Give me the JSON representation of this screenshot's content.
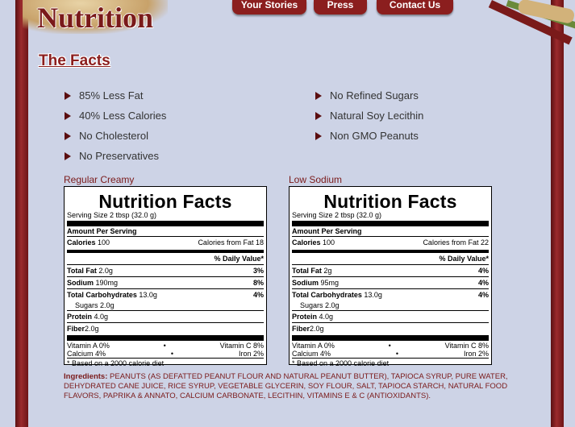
{
  "header": {
    "title": "Nutrition",
    "nav": [
      "Your Stories",
      "Press",
      "Contact Us"
    ]
  },
  "section_title": "The Facts",
  "facts_left": [
    "85% Less Fat",
    "40% Less Calories",
    "No Cholesterol",
    "No Preservatives"
  ],
  "facts_right": [
    "No Refined Sugars",
    "Natural Soy Lecithin",
    "Non GMO Peanuts"
  ],
  "labels": [
    {
      "heading": "Regular Creamy",
      "title": "Nutrition Facts",
      "serving_size": "Serving Size 2 tbsp (32.0 g)",
      "amount_per_serving": "Amount Per Serving",
      "calories_label": "Calories",
      "calories": "100",
      "calories_fat_label": "Calories from Fat",
      "calories_fat": "18",
      "daily_value": "% Daily Value",
      "nutrients": [
        {
          "name": "Total Fat",
          "amount": "2.0g",
          "pct": "3%"
        },
        {
          "name": "Sodium",
          "amount": "190mg",
          "pct": "8%"
        },
        {
          "name": "Total Carbohydrates",
          "amount": "13.0g",
          "pct": "4%"
        }
      ],
      "sugars": "Sugars 2.0g",
      "protein_label": "Protein",
      "protein": "4.0g",
      "fiber_label": "Fiber",
      "fiber": "2.0g",
      "vitamin_a": "Vitamin A 0%",
      "vitamin_c": "Vitamin C 8%",
      "calcium": "Calcium 4%",
      "iron": "Iron 2%",
      "dot": "•",
      "footnote": "* Based on a 2000 calorie diet"
    },
    {
      "heading": "Low Sodium",
      "title": "Nutrition Facts",
      "serving_size": "Serving Size 2 tbsp (32.0 g)",
      "amount_per_serving": "Amount Per Serving",
      "calories_label": "Calories",
      "calories": "100",
      "calories_fat_label": "Calories from Fat",
      "calories_fat": "22",
      "daily_value": "% Daily Value",
      "nutrients": [
        {
          "name": "Total Fat",
          "amount": "2g",
          "pct": "4%"
        },
        {
          "name": "Sodium",
          "amount": "95mg",
          "pct": "4%"
        },
        {
          "name": "Total Carbohydrates",
          "amount": "13.0g",
          "pct": "4%"
        }
      ],
      "sugars": "Sugars 2.0g",
      "protein_label": "Protein",
      "protein": "4.0g",
      "fiber_label": "Fiber",
      "fiber": "2.0g",
      "vitamin_a": "Vitamin A 0%",
      "vitamin_c": "Vitamin C 8%",
      "calcium": "Calcium 4%",
      "iron": "Iron 2%",
      "dot": "•",
      "footnote": "* Based on a 2000 calorie diet"
    }
  ],
  "ingredients": {
    "label": "Ingredients:",
    "text": "PEANUTS (AS DEFATTED PEANUT FLOUR AND NATURAL PEANUT BUTTER), TAPIOCA SYRUP, PURE WATER, DEHYDRATED CANE JUICE, RICE SYRUP, VEGETABLE GLYCERIN, SOY FLOUR, SALT, TAPIOCA STARCH, NATURAL FOOD FLAVORS, PAPRIKA & ANNATO, CALCIUM CARBONATE, LECITHIN, VITAMINS E & C (ANTIOXIDANTS)."
  },
  "colors": {
    "accent": "#8b1e1e",
    "background": "#cdd3e6"
  }
}
